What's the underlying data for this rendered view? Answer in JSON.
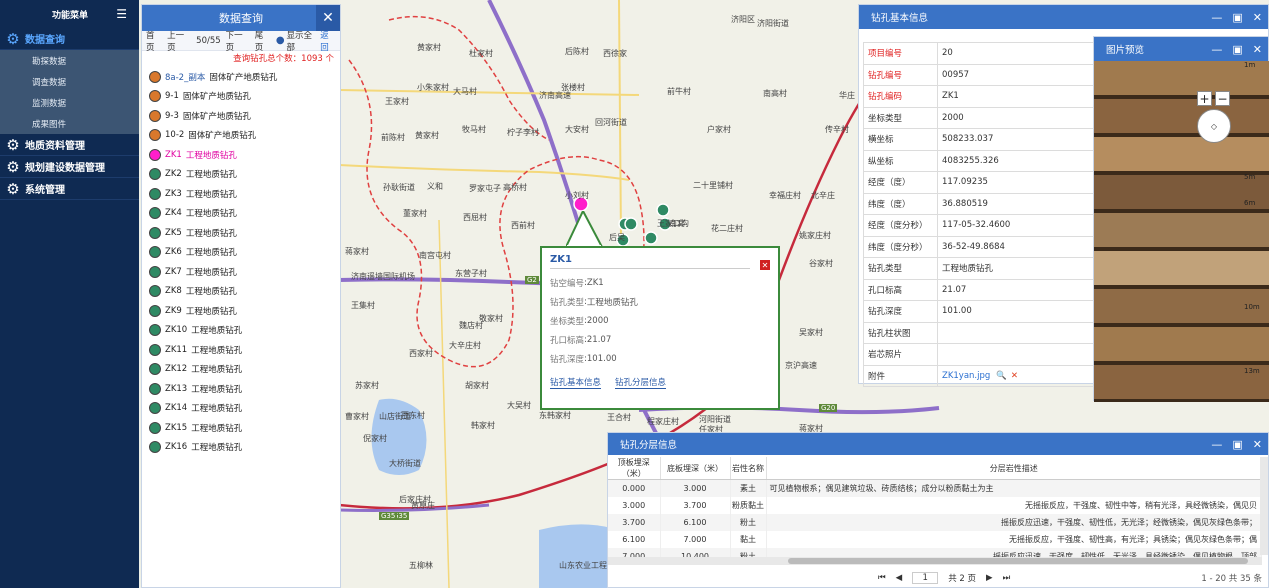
{
  "nav": {
    "title": "功能菜单",
    "sections": [
      {
        "label": "数据查询",
        "active": true,
        "items": [
          "勘探数据",
          "调查数据",
          "监测数据",
          "成果图件"
        ]
      },
      {
        "label": "地质资料管理"
      },
      {
        "label": "规划建设数据管理"
      },
      {
        "label": "系统管理"
      }
    ]
  },
  "query": {
    "title": "数据查询",
    "pager": {
      "first": "首页",
      "prev": "上一页",
      "page": "50/55",
      "next": "下一页",
      "last": "尾页",
      "show_all": "显示全部",
      "back": "返回"
    },
    "total": "查询钻孔总个数：1093 个",
    "items": [
      {
        "name": "8a-2_副本",
        "type": "固体矿产地质钻孔",
        "color": "#d9782c"
      },
      {
        "name": "9-1",
        "type": "固体矿产地质钻孔",
        "color": "#d9782c"
      },
      {
        "name": "9-3",
        "type": "固体矿产地质钻孔",
        "color": "#d9782c"
      },
      {
        "name": "10-2",
        "type": "固体矿产地质钻孔",
        "color": "#d9782c"
      },
      {
        "name": "ZK1",
        "type": "工程地质钻孔",
        "color": "#ff1ecb"
      },
      {
        "name": "ZK2",
        "type": "工程地质钻孔",
        "color": "#2f8a64"
      },
      {
        "name": "ZK3",
        "type": "工程地质钻孔",
        "color": "#2f8a64"
      },
      {
        "name": "ZK4",
        "type": "工程地质钻孔",
        "color": "#2f8a64"
      },
      {
        "name": "ZK5",
        "type": "工程地质钻孔",
        "color": "#2f8a64"
      },
      {
        "name": "ZK6",
        "type": "工程地质钻孔",
        "color": "#2f8a64"
      },
      {
        "name": "ZK7",
        "type": "工程地质钻孔",
        "color": "#2f8a64"
      },
      {
        "name": "ZK8",
        "type": "工程地质钻孔",
        "color": "#2f8a64"
      },
      {
        "name": "ZK9",
        "type": "工程地质钻孔",
        "color": "#2f8a64"
      },
      {
        "name": "ZK10",
        "type": "工程地质钻孔",
        "color": "#2f8a64"
      },
      {
        "name": "ZK11",
        "type": "工程地质钻孔",
        "color": "#2f8a64"
      },
      {
        "name": "ZK12",
        "type": "工程地质钻孔",
        "color": "#2f8a64"
      },
      {
        "name": "ZK13",
        "type": "工程地质钻孔",
        "color": "#2f8a64"
      },
      {
        "name": "ZK14",
        "type": "工程地质钻孔",
        "color": "#2f8a64"
      },
      {
        "name": "ZK15",
        "type": "工程地质钻孔",
        "color": "#2f8a64"
      },
      {
        "name": "ZK16",
        "type": "工程地质钻孔",
        "color": "#2f8a64"
      }
    ]
  },
  "map": {
    "labels": [
      "黄家村",
      "杜家村",
      "后陈村",
      "西徐家",
      "济阳街道",
      "王家村",
      "小朱家村",
      "大马村",
      "张楼村",
      "前牛村",
      "南高村",
      "华庄",
      "前陈村",
      "黄家村",
      "牧马村",
      "柠子李村",
      "大安村",
      "回河街道",
      "户家村",
      "传辛村",
      "孙耿街道",
      "义和",
      "罗家屯子",
      "高桥村",
      "小刘村",
      "二十里铺村",
      "幸福庄村",
      "北辛庄",
      "董家村",
      "西屈村",
      "西前村",
      "南窝",
      "王家口沟",
      "花二庄村",
      "姚家庄村",
      "蒋家村",
      "南宫屯村",
      "东营子村",
      "后吴",
      "谷家村",
      "济南遥墙国际机场",
      "王集村",
      "敬家村",
      "吴家村",
      "大辛庄村",
      "西家村",
      "魏店村",
      "苏家村",
      "曹家村",
      "西东村",
      "胡家村",
      "大吴村",
      "韩家村",
      "倪家村",
      "东家村",
      "王合村",
      "程家庄村",
      "河阳街道",
      "任家村",
      "大桥街道",
      "山店街道",
      "后家庄村",
      "黄原庄",
      "五柳林",
      "山东农业工程学院",
      "济阳区",
      "京沪高速",
      "济南高速",
      "东韩家村",
      "蒋家村"
    ],
    "road_labels": [
      "G2",
      "G35",
      "G20",
      "G35"
    ]
  },
  "popup": {
    "title": "ZK1",
    "rows": [
      {
        "k": "钻空编号",
        "v": "ZK1"
      },
      {
        "k": "钻孔类型",
        "v": "工程地质钻孔"
      },
      {
        "k": "坐标类型",
        "v": "2000"
      },
      {
        "k": "孔口标高",
        "v": "21.07"
      },
      {
        "k": "钻孔深度",
        "v": "101.00"
      }
    ],
    "links": [
      "钻孔基本信息",
      "钻孔分层信息"
    ]
  },
  "info": {
    "title": "钻孔基本信息",
    "rows": [
      {
        "k": "项目编号",
        "v": "20",
        "red": true
      },
      {
        "k": "钻孔编号",
        "v": "00957",
        "red": true
      },
      {
        "k": "钻孔编码",
        "v": "ZK1",
        "red": true
      },
      {
        "k": "坐标类型",
        "v": "2000"
      },
      {
        "k": "横坐标",
        "v": "508233.037"
      },
      {
        "k": "纵坐标",
        "v": "4083255.326"
      },
      {
        "k": "经度（度）",
        "v": "117.09235"
      },
      {
        "k": "纬度（度）",
        "v": "36.880519"
      },
      {
        "k": "经度（度分秒）",
        "v": "117-05-32.4600"
      },
      {
        "k": "纬度（度分秒）",
        "v": "36-52-49.8684"
      },
      {
        "k": "钻孔类型",
        "v": "工程地质钻孔"
      },
      {
        "k": "孔口标高",
        "v": "21.07"
      },
      {
        "k": "钻孔深度",
        "v": "101.00"
      },
      {
        "k": "钻孔柱状图",
        "v": ""
      },
      {
        "k": "岩芯照片",
        "v": ""
      }
    ],
    "attachment_label": "附件",
    "attachment_file": "ZK1yan.jpg"
  },
  "preview": {
    "title": "图片预览",
    "scale_marks": [
      "1m",
      "5m",
      "6m",
      "10m",
      "13m"
    ]
  },
  "layer": {
    "title": "钻孔分层信息",
    "columns": [
      "顶板埋深（米）",
      "底板埋深（米）",
      "岩性名称",
      "分层岩性描述"
    ],
    "rows": [
      {
        "top": "0.000",
        "bottom": "3.000",
        "name": "素土",
        "desc": "可见植物根系；偶见建筑垃圾、砖质结核；成分以粉质黏土为主"
      },
      {
        "top": "3.000",
        "bottom": "3.700",
        "name": "粉质黏土",
        "desc": "无摇振反应，干强度、韧性中等，稍有光泽，具经微锈染，偶见贝"
      },
      {
        "top": "3.700",
        "bottom": "6.100",
        "name": "粉土",
        "desc": "摇振反应迅速，干强度、韧性低，无光泽；经微锈染，偶见灰绿色条带；"
      },
      {
        "top": "6.100",
        "bottom": "7.000",
        "name": "黏土",
        "desc": "无摇振反应，干强度、韧性高，有光泽；具锈染；偶见灰绿色条带；偶"
      },
      {
        "top": "7.000",
        "bottom": "10.400",
        "name": "粉土",
        "desc": "摇振反应迅速，干强度、韧性低，无光泽，具经微锈染，偶见植物根，顶部"
      }
    ],
    "footer": {
      "page": "1",
      "pages": "共 2 页",
      "summary": "1 - 20  共 35 条"
    }
  }
}
